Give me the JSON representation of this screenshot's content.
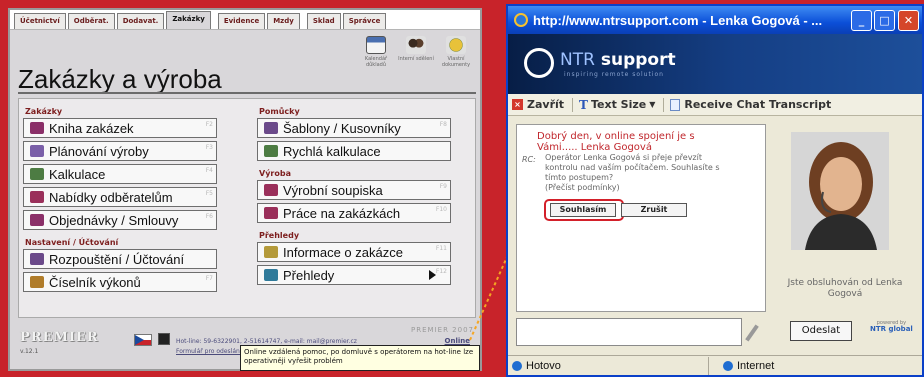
{
  "left_app": {
    "tabs": [
      "Účetnictví",
      "Odběrat.",
      "Dodavat.",
      "Zakázky",
      "Evidence",
      "Mzdy",
      "Sklad",
      "Správce"
    ],
    "active_tab": "Zakázky",
    "title": "Zakázky a výroba",
    "tools": [
      {
        "label": "Kalendář důkladů",
        "icon": "calendar-icon"
      },
      {
        "label": "Interní sdělení",
        "icon": "people-icon"
      },
      {
        "label": "Vlastní dokumenty",
        "icon": "documents-icon"
      }
    ],
    "sections": {
      "zakazky": "Zakázky",
      "pomucky": "Pomůcky",
      "vyroba": "Výroba",
      "nastaveni": "Nastavení / Účtování",
      "prehledy": "Přehledy"
    },
    "buttons": {
      "kniha": {
        "label": "Kniha zakázek",
        "key": "F2"
      },
      "planovani": {
        "label": "Plánování výroby",
        "key": "F3"
      },
      "kalkulace": {
        "label": "Kalkulace",
        "key": "F4"
      },
      "nabidky": {
        "label": "Nabídky odběratelům",
        "key": "F5"
      },
      "objednavky": {
        "label": "Objednávky / Smlouvy",
        "key": "F6"
      },
      "sablony": {
        "label": "Šablony / Kusovníky",
        "key": "F8"
      },
      "rychla": {
        "label": "Rychlá kalkulace",
        "key": ""
      },
      "soupiska": {
        "label": "Výrobní soupiska",
        "key": "F9"
      },
      "prace": {
        "label": "Práce na zakázkách",
        "key": "F10"
      },
      "rozpousteni": {
        "label": "Rozpouštění / Účtování",
        "key": ""
      },
      "ciselnik": {
        "label": "Číselník výkonů",
        "key": "F7"
      },
      "informace": {
        "label": "Informace o zakázce",
        "key": "F11"
      },
      "prehledy": {
        "label": "Přehledy",
        "key": "F12"
      }
    },
    "footer": {
      "logo": "PREMIER",
      "version": "v.12.1",
      "brand": "PREMIER 2007",
      "hotline": "Hot-line: 59-6322901, 2-51614747, e-mail: mail@premier.cz",
      "form_link": "Formulář pro odeslání",
      "online": "Online"
    },
    "tooltip": "Online vzdálená pomoc, po domluvě s operátorem na hot-line lze operativněji vyřešit problém"
  },
  "chat_window": {
    "title": "http://www.ntrsupport.com - Lenka Gogová - ...",
    "brand_ntr": "NTR",
    "brand_support": "support",
    "brand_tagline": "inspiring remote solution",
    "toolbar": {
      "close": "Zavřít",
      "text_size": "Text Size",
      "transcript": "Receive Chat Transcript"
    },
    "greeting": "Dobrý den, v online spojení je s Vámi..... Lenka Gogová",
    "rc_label": "RC:",
    "rc_message": "Operátor Lenka Gogová si přeje převzít kontrolu nad vaším počítačem. Souhlasíte s tímto postupem?",
    "read_terms": "(Přečíst podmínky)",
    "agree": "Souhlasím",
    "cancel": "Zrušit",
    "served_by": "Jste obsluhován od Lenka Gogová",
    "send": "Odeslat",
    "powered_by": "powered by",
    "powered_brand": "NTR global",
    "status_left": "Hotovo",
    "status_right": "Internet"
  },
  "colors": {
    "background": "#c8232a",
    "section_heading": "#7d1e1e",
    "chat_red": "#c0272d",
    "xp_blue": "#0b4fd8",
    "arrow": "#f5a623"
  }
}
